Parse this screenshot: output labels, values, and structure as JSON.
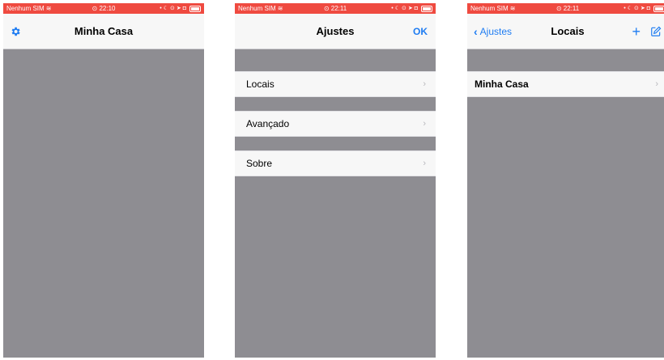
{
  "colors": {
    "status_bar_red": "#ef4a40",
    "nav_bg": "#f7f7f7",
    "content_gray": "#8e8d92",
    "accent_blue": "#1e7cf2",
    "chevron_gray": "#b9b9bd"
  },
  "screens": [
    {
      "status": {
        "carrier": "Nenhum SIM",
        "time": "⊙ 22:10"
      },
      "nav": {
        "left_icon": "gear-icon",
        "title": "Minha Casa"
      }
    },
    {
      "status": {
        "carrier": "Nenhum SIM",
        "time": "⊙ 22:11"
      },
      "nav": {
        "title": "Ajustes",
        "right_label": "OK"
      },
      "rows": [
        {
          "label": "Locais",
          "chevron": "›"
        },
        {
          "label": "Avançado",
          "chevron": "›"
        },
        {
          "label": "Sobre",
          "chevron": "›"
        }
      ]
    },
    {
      "status": {
        "carrier": "Nenhum SIM",
        "time": "⊙ 22:11"
      },
      "nav": {
        "back_glyph": "‹",
        "back_label": "Ajustes",
        "title": "Locais",
        "add_icon": "plus-icon",
        "add_glyph": "+",
        "edit_icon": "compose-icon"
      },
      "rows": [
        {
          "label": "Minha Casa",
          "chevron": "›"
        }
      ]
    }
  ]
}
